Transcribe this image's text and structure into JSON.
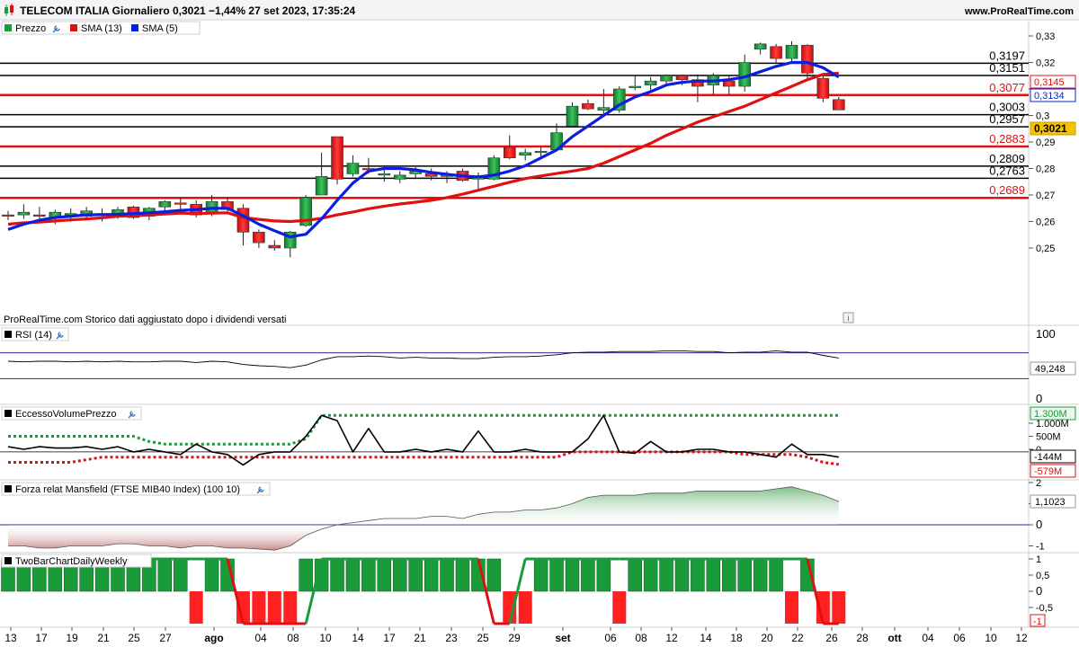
{
  "header": {
    "title": "TELECOM ITALIA Giornaliero 0,3021 −1,44% 27 set 2023, 17:35:24",
    "site": "www.ProRealTime.com"
  },
  "price_panel": {
    "legend": [
      {
        "label": "Prezzo",
        "color": "#1a9b3a"
      },
      {
        "label": "SMA (13)",
        "color": "#e01010"
      },
      {
        "label": "SMA (5)",
        "color": "#0a1ee0"
      }
    ],
    "note": "ProRealTime.com  Storico dati aggiustato dopo i dividendi versati",
    "info_icon_label": "i"
  },
  "chart_data": [
    {
      "type": "candlestick",
      "title": "TELECOM ITALIA Giornaliero",
      "ylim": [
        0.24,
        0.335
      ],
      "y_ticks": [
        "0,33",
        "0,32",
        "0,31",
        "0,3",
        "0,29",
        "0,28",
        "0,27",
        "0,26",
        "0,25"
      ],
      "x_tick_labels": [
        "13",
        "17",
        "19",
        "21",
        "25",
        "27",
        "ago",
        "04",
        "08",
        "10",
        "14",
        "17",
        "21",
        "23",
        "25",
        "29",
        "set",
        "06",
        "08",
        "12",
        "14",
        "18",
        "20",
        "22",
        "26",
        "28",
        "ott",
        "04",
        "06",
        "10",
        "12"
      ],
      "candles": [
        {
          "o": 0.2625,
          "h": 0.264,
          "l": 0.2605,
          "c": 0.262
        },
        {
          "o": 0.2625,
          "h": 0.2665,
          "l": 0.261,
          "c": 0.2635
        },
        {
          "o": 0.2625,
          "h": 0.2655,
          "l": 0.2605,
          "c": 0.262
        },
        {
          "o": 0.2615,
          "h": 0.2645,
          "l": 0.259,
          "c": 0.2635
        },
        {
          "o": 0.2625,
          "h": 0.265,
          "l": 0.26,
          "c": 0.263
        },
        {
          "o": 0.262,
          "h": 0.2655,
          "l": 0.2605,
          "c": 0.264
        },
        {
          "o": 0.263,
          "h": 0.265,
          "l": 0.26,
          "c": 0.2625
        },
        {
          "o": 0.2625,
          "h": 0.2655,
          "l": 0.261,
          "c": 0.2645
        },
        {
          "o": 0.2655,
          "h": 0.266,
          "l": 0.261,
          "c": 0.2615
        },
        {
          "o": 0.262,
          "h": 0.2655,
          "l": 0.2605,
          "c": 0.265
        },
        {
          "o": 0.2655,
          "h": 0.268,
          "l": 0.263,
          "c": 0.2675
        },
        {
          "o": 0.267,
          "h": 0.269,
          "l": 0.264,
          "c": 0.2665
        },
        {
          "o": 0.2665,
          "h": 0.268,
          "l": 0.2615,
          "c": 0.2625
        },
        {
          "o": 0.263,
          "h": 0.27,
          "l": 0.262,
          "c": 0.2675
        },
        {
          "o": 0.2675,
          "h": 0.269,
          "l": 0.263,
          "c": 0.2645
        },
        {
          "o": 0.265,
          "h": 0.2665,
          "l": 0.251,
          "c": 0.256
        },
        {
          "o": 0.256,
          "h": 0.257,
          "l": 0.25,
          "c": 0.252
        },
        {
          "o": 0.251,
          "h": 0.253,
          "l": 0.249,
          "c": 0.25
        },
        {
          "o": 0.25,
          "h": 0.2565,
          "l": 0.2465,
          "c": 0.256
        },
        {
          "o": 0.2585,
          "h": 0.27,
          "l": 0.258,
          "c": 0.269
        },
        {
          "o": 0.27,
          "h": 0.286,
          "l": 0.27,
          "c": 0.277
        },
        {
          "o": 0.292,
          "h": 0.292,
          "l": 0.274,
          "c": 0.276
        },
        {
          "o": 0.278,
          "h": 0.285,
          "l": 0.277,
          "c": 0.282
        },
        {
          "o": 0.28,
          "h": 0.284,
          "l": 0.278,
          "c": 0.2795
        },
        {
          "o": 0.2775,
          "h": 0.28,
          "l": 0.275,
          "c": 0.278
        },
        {
          "o": 0.276,
          "h": 0.279,
          "l": 0.2745,
          "c": 0.2775
        },
        {
          "o": 0.278,
          "h": 0.2805,
          "l": 0.276,
          "c": 0.279
        },
        {
          "o": 0.278,
          "h": 0.28,
          "l": 0.2755,
          "c": 0.277
        },
        {
          "o": 0.277,
          "h": 0.279,
          "l": 0.2745,
          "c": 0.2775
        },
        {
          "o": 0.279,
          "h": 0.28,
          "l": 0.275,
          "c": 0.2755
        },
        {
          "o": 0.276,
          "h": 0.2785,
          "l": 0.272,
          "c": 0.277
        },
        {
          "o": 0.276,
          "h": 0.285,
          "l": 0.2755,
          "c": 0.284
        },
        {
          "o": 0.288,
          "h": 0.2925,
          "l": 0.2835,
          "c": 0.284
        },
        {
          "o": 0.285,
          "h": 0.2875,
          "l": 0.283,
          "c": 0.286
        },
        {
          "o": 0.286,
          "h": 0.288,
          "l": 0.284,
          "c": 0.2865
        },
        {
          "o": 0.287,
          "h": 0.297,
          "l": 0.287,
          "c": 0.2935
        },
        {
          "o": 0.296,
          "h": 0.305,
          "l": 0.296,
          "c": 0.3035
        },
        {
          "o": 0.3045,
          "h": 0.306,
          "l": 0.302,
          "c": 0.3025
        },
        {
          "o": 0.302,
          "h": 0.31,
          "l": 0.3,
          "c": 0.303
        },
        {
          "o": 0.302,
          "h": 0.311,
          "l": 0.301,
          "c": 0.31
        },
        {
          "o": 0.3105,
          "h": 0.315,
          "l": 0.3095,
          "c": 0.311
        },
        {
          "o": 0.3115,
          "h": 0.3145,
          "l": 0.309,
          "c": 0.313
        },
        {
          "o": 0.313,
          "h": 0.3155,
          "l": 0.3115,
          "c": 0.315
        },
        {
          "o": 0.315,
          "h": 0.3155,
          "l": 0.3115,
          "c": 0.3135
        },
        {
          "o": 0.3135,
          "h": 0.3155,
          "l": 0.305,
          "c": 0.311
        },
        {
          "o": 0.3115,
          "h": 0.316,
          "l": 0.308,
          "c": 0.315
        },
        {
          "o": 0.313,
          "h": 0.315,
          "l": 0.308,
          "c": 0.311
        },
        {
          "o": 0.311,
          "h": 0.323,
          "l": 0.309,
          "c": 0.32
        },
        {
          "o": 0.325,
          "h": 0.3275,
          "l": 0.323,
          "c": 0.327
        },
        {
          "o": 0.326,
          "h": 0.327,
          "l": 0.32,
          "c": 0.3215
        },
        {
          "o": 0.3215,
          "h": 0.328,
          "l": 0.32,
          "c": 0.3265
        },
        {
          "o": 0.3265,
          "h": 0.327,
          "l": 0.313,
          "c": 0.316
        },
        {
          "o": 0.314,
          "h": 0.316,
          "l": 0.305,
          "c": 0.3065
        },
        {
          "o": 0.306,
          "h": 0.307,
          "l": 0.3021,
          "c": 0.3021
        }
      ],
      "sma13": [
        0.259,
        0.2595,
        0.2598,
        0.2602,
        0.2606,
        0.261,
        0.2614,
        0.262,
        0.2622,
        0.2625,
        0.2628,
        0.2632,
        0.263,
        0.2632,
        0.2633,
        0.2615,
        0.2608,
        0.2602,
        0.26,
        0.2604,
        0.2612,
        0.2625,
        0.2636,
        0.2648,
        0.2658,
        0.2666,
        0.2673,
        0.268,
        0.269,
        0.2703,
        0.2718,
        0.2733,
        0.2748,
        0.2762,
        0.2772,
        0.2781,
        0.279,
        0.28,
        0.282,
        0.2845,
        0.287,
        0.2895,
        0.2925,
        0.295,
        0.2975,
        0.2995,
        0.3015,
        0.3035,
        0.306,
        0.3085,
        0.311,
        0.3135,
        0.3155,
        0.316
      ],
      "sma5": [
        0.257,
        0.259,
        0.2605,
        0.2615,
        0.262,
        0.2625,
        0.2626,
        0.2627,
        0.263,
        0.2633,
        0.2637,
        0.2642,
        0.2645,
        0.265,
        0.265,
        0.2622,
        0.259,
        0.2565,
        0.2542,
        0.2552,
        0.261,
        0.268,
        0.2745,
        0.279,
        0.28,
        0.28,
        0.2795,
        0.2785,
        0.2778,
        0.2772,
        0.2768,
        0.2775,
        0.279,
        0.281,
        0.284,
        0.287,
        0.292,
        0.296,
        0.3,
        0.304,
        0.307,
        0.309,
        0.3115,
        0.3125,
        0.313,
        0.313,
        0.3135,
        0.3145,
        0.3165,
        0.3185,
        0.32,
        0.32,
        0.318,
        0.3145
      ],
      "levels": [
        {
          "value": 0.3197,
          "label": "0,3197",
          "color": "#000000"
        },
        {
          "value": 0.3151,
          "label": "0,3151",
          "color": "#000000"
        },
        {
          "value": 0.3077,
          "label": "0,3077",
          "color": "#e01010"
        },
        {
          "value": 0.3003,
          "label": "0,3003",
          "color": "#000000"
        },
        {
          "value": 0.2957,
          "label": "0,2957",
          "color": "#000000"
        },
        {
          "value": 0.2883,
          "label": "0,2883",
          "color": "#e01010"
        },
        {
          "value": 0.2809,
          "label": "0,2809",
          "color": "#000000"
        },
        {
          "value": 0.2763,
          "label": "0,2763",
          "color": "#000000"
        },
        {
          "value": 0.2689,
          "label": "0,2689",
          "color": "#e01010"
        }
      ],
      "markers": [
        {
          "value": 0.3145,
          "label": "0,3145",
          "color": "#e01010"
        },
        {
          "value": 0.3134,
          "label": "0,3134",
          "color": "#0a1ee0"
        },
        {
          "value": 0.3021,
          "label": "0,3021",
          "color": "#f5c400"
        }
      ]
    },
    {
      "type": "line",
      "title": "RSI (14)",
      "ylim": [
        0,
        100
      ],
      "y_ticks": [
        "100",
        "0"
      ],
      "bands": [
        70,
        30
      ],
      "current_label": "49,248",
      "values": [
        57,
        56,
        57,
        57,
        56,
        57,
        56,
        57,
        56,
        56,
        57,
        57,
        55,
        57,
        56,
        52,
        50,
        49,
        47,
        51,
        59,
        64,
        64,
        65,
        64,
        62,
        63,
        62,
        62,
        61,
        61,
        63,
        64,
        64,
        65,
        67,
        70,
        71,
        71,
        72,
        72,
        72,
        73,
        73,
        72,
        72,
        70,
        71,
        71,
        73,
        71,
        71,
        66,
        62
      ]
    },
    {
      "type": "line",
      "title": "EccessoVolumePrezzo",
      "ylim": [
        -800,
        1400
      ],
      "y_ticks": [
        "1.000M",
        "500M",
        "0"
      ],
      "current_labels": [
        "1.300M",
        "-144M",
        "-579M"
      ],
      "values": [
        100,
        0,
        100,
        50,
        50,
        100,
        0,
        100,
        -100,
        0,
        -100,
        -200,
        200,
        -100,
        -200,
        -600,
        -200,
        -100,
        -100,
        500,
        1300,
        1100,
        -100,
        800,
        -100,
        -100,
        0,
        -100,
        0,
        -100,
        700,
        -100,
        -100,
        0,
        -100,
        -100,
        -100,
        400,
        1300,
        -100,
        -150,
        300,
        -100,
        -100,
        0,
        0,
        -100,
        -100,
        -200,
        -300,
        200,
        -200,
        -200,
        -300
      ],
      "upper_band": [
        500,
        500,
        500,
        500,
        500,
        500,
        500,
        500,
        500,
        300,
        200,
        200,
        200,
        200,
        200,
        200,
        200,
        200,
        200,
        400,
        1300,
        1300,
        1300,
        1300,
        1300,
        1300,
        1300,
        1300,
        1300,
        1300,
        1300,
        1300,
        1300,
        1300,
        1300,
        1300,
        1300,
        1300,
        1300,
        1300,
        1300,
        1300,
        1300,
        1300,
        1300,
        1300,
        1300,
        1300,
        1300,
        1300,
        1300,
        1300,
        1300,
        1300
      ],
      "lower_band": [
        -500,
        -500,
        -500,
        -500,
        -500,
        -400,
        -300,
        -300,
        -300,
        -300,
        -300,
        -300,
        -300,
        -300,
        -300,
        -300,
        -300,
        -300,
        -300,
        -300,
        -300,
        -300,
        -300,
        -300,
        -300,
        -300,
        -300,
        -300,
        -300,
        -300,
        -300,
        -300,
        -300,
        -300,
        -300,
        -300,
        -100,
        -100,
        -100,
        -100,
        -100,
        -100,
        -100,
        -100,
        -100,
        -100,
        -100,
        -200,
        -200,
        -200,
        -200,
        -300,
        -500,
        -579
      ]
    },
    {
      "type": "area",
      "title": "Forza relat Mansfield (FTSE MIB40 Index) (100 10)",
      "ylim": [
        -1.2,
        2.1
      ],
      "y_ticks": [
        "2",
        "1",
        "0",
        "-1"
      ],
      "current_label": "1,1023",
      "values": [
        -1,
        -1,
        -1.1,
        -1.1,
        -1,
        -1,
        -1,
        -0.9,
        -0.9,
        -1,
        -1,
        -1.1,
        -1,
        -1,
        -1.1,
        -1.1,
        -1.15,
        -1.2,
        -1.0,
        -0.5,
        -0.2,
        0,
        0.1,
        0.2,
        0.3,
        0.3,
        0.3,
        0.4,
        0.4,
        0.3,
        0.5,
        0.6,
        0.6,
        0.7,
        0.7,
        0.8,
        1,
        1.3,
        1.4,
        1.4,
        1.4,
        1.5,
        1.5,
        1.5,
        1.6,
        1.6,
        1.6,
        1.6,
        1.6,
        1.7,
        1.8,
        1.6,
        1.4,
        1.1
      ]
    },
    {
      "type": "bar",
      "title": "TwoBarChartDailyWeekly",
      "ylim": [
        -1.1,
        1.1
      ],
      "y_ticks": [
        "1",
        "0,5",
        "0",
        "-0,5"
      ],
      "current_label": "-1",
      "values": [
        1,
        1,
        1,
        1,
        1,
        1,
        1,
        1,
        1,
        1,
        1,
        1,
        -1,
        1,
        1,
        -1,
        -1,
        -1,
        -1,
        1,
        1,
        1,
        1,
        1,
        1,
        1,
        1,
        1,
        1,
        1,
        1,
        1,
        -1,
        -1,
        1,
        1,
        1,
        1,
        1,
        -1,
        1,
        1,
        1,
        1,
        1,
        1,
        1,
        1,
        1,
        1,
        -1,
        1,
        -1,
        -1
      ],
      "weekly": [
        1,
        1,
        1,
        1,
        1,
        1,
        1,
        1,
        1,
        1,
        1,
        1,
        1,
        1,
        1,
        -1,
        -1,
        -1,
        -1,
        -1,
        1,
        1,
        1,
        1,
        1,
        1,
        1,
        1,
        1,
        1,
        1,
        -1,
        -1,
        1,
        1,
        1,
        1,
        1,
        1,
        1,
        1,
        1,
        1,
        1,
        1,
        1,
        1,
        1,
        1,
        1,
        1,
        1,
        -1,
        -1
      ]
    }
  ]
}
